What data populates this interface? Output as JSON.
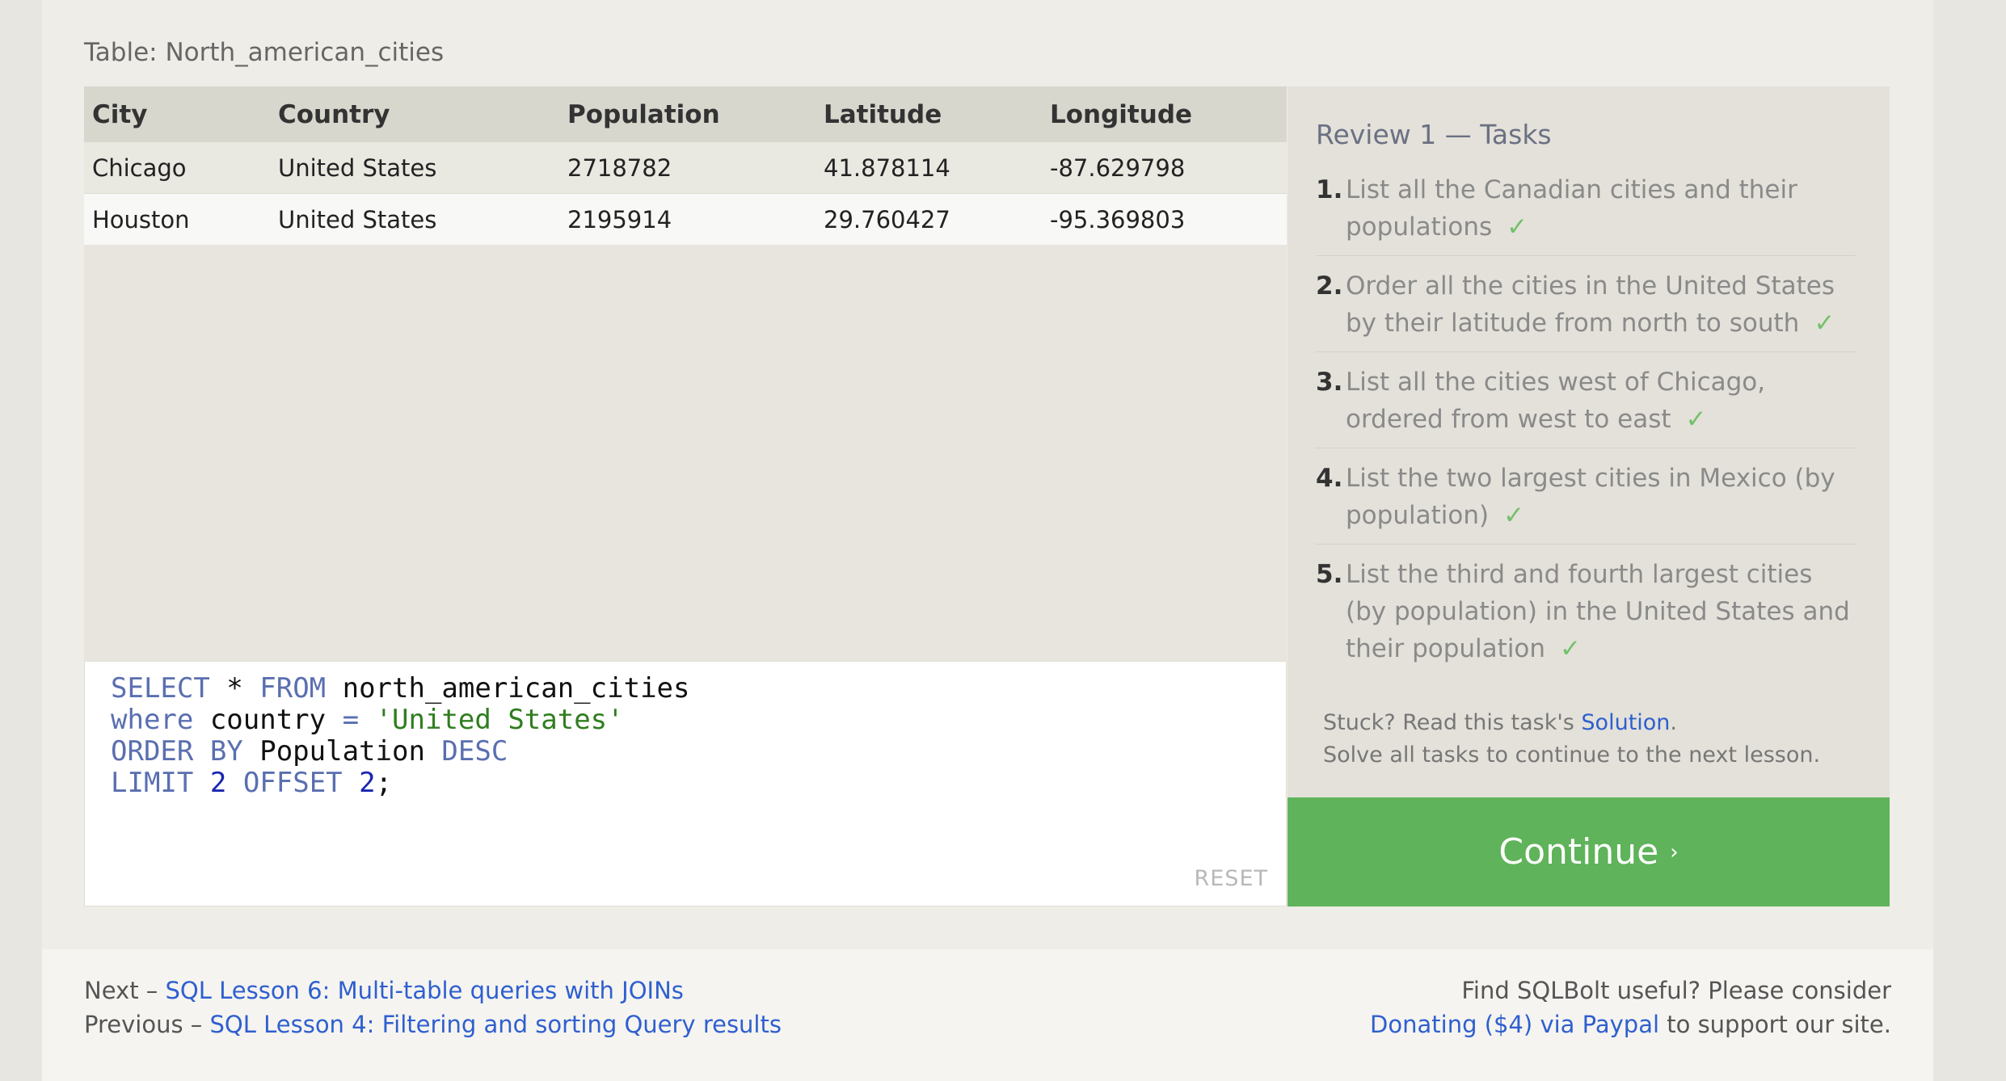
{
  "table_caption": "Table: North_american_cities",
  "results": {
    "columns": [
      "City",
      "Country",
      "Population",
      "Latitude",
      "Longitude"
    ],
    "rows": [
      [
        "Chicago",
        "United States",
        "2718782",
        "41.878114",
        "-87.629798"
      ],
      [
        "Houston",
        "United States",
        "2195914",
        "29.760427",
        "-95.369803"
      ]
    ]
  },
  "editor": {
    "line1": {
      "kw1": "SELECT",
      "rest1": " * ",
      "kw2": "FROM",
      "rest2": " north_american_cities"
    },
    "line2": {
      "kw1": "where",
      "rest1": " country ",
      "op": "=",
      "sp": " ",
      "str": "'United States'"
    },
    "line3": {
      "kw1": "ORDER BY",
      "rest1": " Population ",
      "kw2": "DESC"
    },
    "line4": {
      "kw1": "LIMIT",
      "sp1": " ",
      "num1": "2",
      "sp2": " ",
      "kw2": "OFFSET",
      "sp3": " ",
      "num2": "2",
      "end": ";"
    },
    "reset_label": "RESET"
  },
  "tasks": {
    "title": "Review 1 — Tasks",
    "items": [
      {
        "num": "1.",
        "text": "List all the Canadian cities and their populations",
        "check": "✓"
      },
      {
        "num": "2.",
        "text": "Order all the cities in the United States by their latitude from north to south",
        "check": "✓"
      },
      {
        "num": "3.",
        "text": "List all the cities west of Chicago, ordered from west to east",
        "check": "✓"
      },
      {
        "num": "4.",
        "text": "List the two largest cities in Mexico (by population)",
        "check": "✓"
      },
      {
        "num": "5.",
        "text": "List the third and fourth largest cities (by population) in the United States and their population",
        "check": "✓"
      }
    ],
    "stuck_prefix": "Stuck? Read this task's ",
    "solution_link": "Solution",
    "stuck_suffix": ".",
    "solve_all": "Solve all tasks to continue to the next lesson."
  },
  "continue_button": {
    "label": "Continue",
    "chevron": "›"
  },
  "footer": {
    "next_prefix": "Next – ",
    "next_link": "SQL Lesson 6: Multi-table queries with JOINs",
    "prev_prefix": "Previous – ",
    "prev_link": "SQL Lesson 4: Filtering and sorting Query results",
    "donate_line1": "Find SQLBolt useful? Please consider",
    "donate_link": "Donating ($4) via Paypal",
    "donate_suffix": " to support our site."
  },
  "colors": {
    "continue_bg": "#5fb35a",
    "link": "#2f5fcf",
    "check": "#73c06a"
  }
}
